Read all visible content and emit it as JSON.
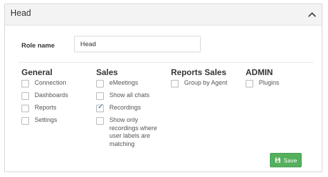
{
  "panel": {
    "title": "Head"
  },
  "role": {
    "label": "Role name",
    "value": "Head"
  },
  "groups": [
    {
      "title": "General",
      "items": [
        {
          "label": "Connection",
          "checked": false
        },
        {
          "label": "Dashboards",
          "checked": false
        },
        {
          "label": "Reports",
          "checked": false
        },
        {
          "label": "Settings",
          "checked": false
        }
      ]
    },
    {
      "title": "Sales",
      "items": [
        {
          "label": "eMeetings",
          "checked": false
        },
        {
          "label": "Show all chats",
          "checked": false
        },
        {
          "label": "Recordings",
          "checked": true
        },
        {
          "label": "Show only recordings where user labels are matching",
          "checked": false
        }
      ]
    },
    {
      "title": "Reports Sales",
      "items": [
        {
          "label": "Group by Agent",
          "checked": false
        }
      ]
    },
    {
      "title": "ADMIN",
      "items": [
        {
          "label": "Plugins",
          "checked": false
        }
      ]
    }
  ],
  "save_button": {
    "label": "Save",
    "color": "#55b05e"
  }
}
